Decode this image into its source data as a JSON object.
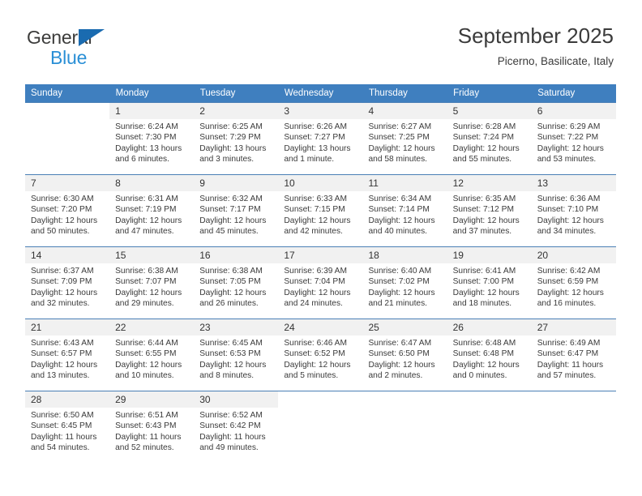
{
  "brand": {
    "name_part1": "General",
    "name_part2": "Blue",
    "triangle_icon": "triangle-icon",
    "color_dark": "#3c3c3b",
    "color_blue": "#2a8fd6",
    "color_triangle": "#1a6bb0"
  },
  "header": {
    "title": "September 2025",
    "subtitle": "Picerno, Basilicate, Italy"
  },
  "theme": {
    "header_bg": "#3f7fbf",
    "header_text": "#ffffff",
    "daynum_bg": "#f1f1f1",
    "row_line": "#4a7fb5",
    "body_text": "#3a3a3a"
  },
  "weekdays": [
    "Sunday",
    "Monday",
    "Tuesday",
    "Wednesday",
    "Thursday",
    "Friday",
    "Saturday"
  ],
  "labels": {
    "sunrise_prefix": "Sunrise:",
    "sunset_prefix": "Sunset:",
    "daylight_prefix": "Daylight:"
  },
  "weeks": [
    [
      {
        "blank": true
      },
      {
        "day": "1",
        "sunrise": "Sunrise: 6:24 AM",
        "sunset": "Sunset: 7:30 PM",
        "daylight1": "Daylight: 13 hours",
        "daylight2": "and 6 minutes."
      },
      {
        "day": "2",
        "sunrise": "Sunrise: 6:25 AM",
        "sunset": "Sunset: 7:29 PM",
        "daylight1": "Daylight: 13 hours",
        "daylight2": "and 3 minutes."
      },
      {
        "day": "3",
        "sunrise": "Sunrise: 6:26 AM",
        "sunset": "Sunset: 7:27 PM",
        "daylight1": "Daylight: 13 hours",
        "daylight2": "and 1 minute."
      },
      {
        "day": "4",
        "sunrise": "Sunrise: 6:27 AM",
        "sunset": "Sunset: 7:25 PM",
        "daylight1": "Daylight: 12 hours",
        "daylight2": "and 58 minutes."
      },
      {
        "day": "5",
        "sunrise": "Sunrise: 6:28 AM",
        "sunset": "Sunset: 7:24 PM",
        "daylight1": "Daylight: 12 hours",
        "daylight2": "and 55 minutes."
      },
      {
        "day": "6",
        "sunrise": "Sunrise: 6:29 AM",
        "sunset": "Sunset: 7:22 PM",
        "daylight1": "Daylight: 12 hours",
        "daylight2": "and 53 minutes."
      }
    ],
    [
      {
        "day": "7",
        "sunrise": "Sunrise: 6:30 AM",
        "sunset": "Sunset: 7:20 PM",
        "daylight1": "Daylight: 12 hours",
        "daylight2": "and 50 minutes."
      },
      {
        "day": "8",
        "sunrise": "Sunrise: 6:31 AM",
        "sunset": "Sunset: 7:19 PM",
        "daylight1": "Daylight: 12 hours",
        "daylight2": "and 47 minutes."
      },
      {
        "day": "9",
        "sunrise": "Sunrise: 6:32 AM",
        "sunset": "Sunset: 7:17 PM",
        "daylight1": "Daylight: 12 hours",
        "daylight2": "and 45 minutes."
      },
      {
        "day": "10",
        "sunrise": "Sunrise: 6:33 AM",
        "sunset": "Sunset: 7:15 PM",
        "daylight1": "Daylight: 12 hours",
        "daylight2": "and 42 minutes."
      },
      {
        "day": "11",
        "sunrise": "Sunrise: 6:34 AM",
        "sunset": "Sunset: 7:14 PM",
        "daylight1": "Daylight: 12 hours",
        "daylight2": "and 40 minutes."
      },
      {
        "day": "12",
        "sunrise": "Sunrise: 6:35 AM",
        "sunset": "Sunset: 7:12 PM",
        "daylight1": "Daylight: 12 hours",
        "daylight2": "and 37 minutes."
      },
      {
        "day": "13",
        "sunrise": "Sunrise: 6:36 AM",
        "sunset": "Sunset: 7:10 PM",
        "daylight1": "Daylight: 12 hours",
        "daylight2": "and 34 minutes."
      }
    ],
    [
      {
        "day": "14",
        "sunrise": "Sunrise: 6:37 AM",
        "sunset": "Sunset: 7:09 PM",
        "daylight1": "Daylight: 12 hours",
        "daylight2": "and 32 minutes."
      },
      {
        "day": "15",
        "sunrise": "Sunrise: 6:38 AM",
        "sunset": "Sunset: 7:07 PM",
        "daylight1": "Daylight: 12 hours",
        "daylight2": "and 29 minutes."
      },
      {
        "day": "16",
        "sunrise": "Sunrise: 6:38 AM",
        "sunset": "Sunset: 7:05 PM",
        "daylight1": "Daylight: 12 hours",
        "daylight2": "and 26 minutes."
      },
      {
        "day": "17",
        "sunrise": "Sunrise: 6:39 AM",
        "sunset": "Sunset: 7:04 PM",
        "daylight1": "Daylight: 12 hours",
        "daylight2": "and 24 minutes."
      },
      {
        "day": "18",
        "sunrise": "Sunrise: 6:40 AM",
        "sunset": "Sunset: 7:02 PM",
        "daylight1": "Daylight: 12 hours",
        "daylight2": "and 21 minutes."
      },
      {
        "day": "19",
        "sunrise": "Sunrise: 6:41 AM",
        "sunset": "Sunset: 7:00 PM",
        "daylight1": "Daylight: 12 hours",
        "daylight2": "and 18 minutes."
      },
      {
        "day": "20",
        "sunrise": "Sunrise: 6:42 AM",
        "sunset": "Sunset: 6:59 PM",
        "daylight1": "Daylight: 12 hours",
        "daylight2": "and 16 minutes."
      }
    ],
    [
      {
        "day": "21",
        "sunrise": "Sunrise: 6:43 AM",
        "sunset": "Sunset: 6:57 PM",
        "daylight1": "Daylight: 12 hours",
        "daylight2": "and 13 minutes."
      },
      {
        "day": "22",
        "sunrise": "Sunrise: 6:44 AM",
        "sunset": "Sunset: 6:55 PM",
        "daylight1": "Daylight: 12 hours",
        "daylight2": "and 10 minutes."
      },
      {
        "day": "23",
        "sunrise": "Sunrise: 6:45 AM",
        "sunset": "Sunset: 6:53 PM",
        "daylight1": "Daylight: 12 hours",
        "daylight2": "and 8 minutes."
      },
      {
        "day": "24",
        "sunrise": "Sunrise: 6:46 AM",
        "sunset": "Sunset: 6:52 PM",
        "daylight1": "Daylight: 12 hours",
        "daylight2": "and 5 minutes."
      },
      {
        "day": "25",
        "sunrise": "Sunrise: 6:47 AM",
        "sunset": "Sunset: 6:50 PM",
        "daylight1": "Daylight: 12 hours",
        "daylight2": "and 2 minutes."
      },
      {
        "day": "26",
        "sunrise": "Sunrise: 6:48 AM",
        "sunset": "Sunset: 6:48 PM",
        "daylight1": "Daylight: 12 hours",
        "daylight2": "and 0 minutes."
      },
      {
        "day": "27",
        "sunrise": "Sunrise: 6:49 AM",
        "sunset": "Sunset: 6:47 PM",
        "daylight1": "Daylight: 11 hours",
        "daylight2": "and 57 minutes."
      }
    ],
    [
      {
        "day": "28",
        "sunrise": "Sunrise: 6:50 AM",
        "sunset": "Sunset: 6:45 PM",
        "daylight1": "Daylight: 11 hours",
        "daylight2": "and 54 minutes."
      },
      {
        "day": "29",
        "sunrise": "Sunrise: 6:51 AM",
        "sunset": "Sunset: 6:43 PM",
        "daylight1": "Daylight: 11 hours",
        "daylight2": "and 52 minutes."
      },
      {
        "day": "30",
        "sunrise": "Sunrise: 6:52 AM",
        "sunset": "Sunset: 6:42 PM",
        "daylight1": "Daylight: 11 hours",
        "daylight2": "and 49 minutes."
      },
      {
        "blank": true
      },
      {
        "blank": true
      },
      {
        "blank": true
      },
      {
        "blank": true
      }
    ]
  ]
}
